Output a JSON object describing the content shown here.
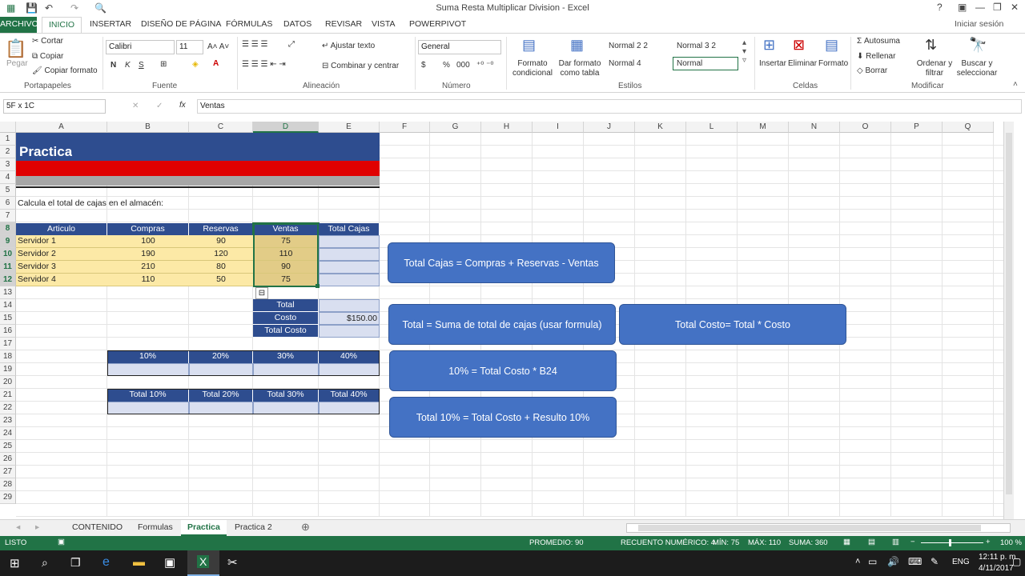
{
  "window": {
    "title": "Suma Resta Multiplicar Division - Excel",
    "help": "?",
    "user": "Iniciar sesión"
  },
  "tabs": [
    "ARCHIVO",
    "INICIO",
    "INSERTAR",
    "DISEÑO DE PÁGINA",
    "FÓRMULAS",
    "DATOS",
    "REVISAR",
    "VISTA",
    "POWERPIVOT"
  ],
  "ribbon": {
    "clipboard": {
      "paste": "Pegar",
      "cut": "Cortar",
      "copy": "Copiar",
      "format_painter": "Copiar formato",
      "group": "Portapapeles"
    },
    "font": {
      "name": "Calibri",
      "size": "11",
      "group": "Fuente",
      "bold": "N",
      "italic": "K",
      "underline": "S"
    },
    "alignment": {
      "wrap": "Ajustar texto",
      "merge": "Combinar y centrar",
      "group": "Alineación"
    },
    "number": {
      "format": "General",
      "group": "Número",
      "percent": "%",
      "thousands": "000"
    },
    "styles": {
      "cond": "Formato condicional",
      "table": "Dar formato como tabla",
      "s1": "Normal 2 2",
      "s2": "Normal 3 2",
      "s3": "Normal 4",
      "s4": "Normal",
      "group": "Estilos"
    },
    "cells": {
      "insert": "Insertar",
      "delete": "Eliminar",
      "format": "Formato",
      "group": "Celdas"
    },
    "editing": {
      "autosum": "Autosuma",
      "fill": "Rellenar",
      "clear": "Borrar",
      "sort": "Ordenar y filtrar",
      "find": "Buscar y seleccionar",
      "group": "Modificar"
    }
  },
  "formula_bar": {
    "namebox": "5F x 1C",
    "fx": "fx",
    "content": "Ventas"
  },
  "columns": [
    "A",
    "B",
    "C",
    "D",
    "E",
    "F",
    "G",
    "H",
    "I",
    "J",
    "K",
    "L",
    "M",
    "N",
    "O",
    "P",
    "Q"
  ],
  "rows": [
    "1",
    "2",
    "3",
    "4",
    "5",
    "6",
    "7",
    "8",
    "9",
    "10",
    "11",
    "12",
    "13",
    "14",
    "15",
    "16",
    "17",
    "18",
    "19",
    "20",
    "21",
    "22",
    "23",
    "24",
    "25",
    "26",
    "27",
    "28",
    "29"
  ],
  "sheet": {
    "banner_title": "Practica",
    "instruction": "Calcula el total de cajas en el almacén:",
    "table_headers": [
      "Articulo",
      "Compras",
      "Reservas",
      "Ventas",
      "Total Cajas"
    ],
    "table_rows": [
      [
        "Servidor 1",
        "100",
        "90",
        "75",
        ""
      ],
      [
        "Servidor 2",
        "190",
        "120",
        "110",
        ""
      ],
      [
        "Servidor 3",
        "210",
        "80",
        "90",
        ""
      ],
      [
        "Servidor 4",
        "110",
        "50",
        "75",
        ""
      ]
    ],
    "summary_labels": [
      "Total",
      "Costo",
      "Total Costo"
    ],
    "summary_values": [
      "",
      "$150.00",
      ""
    ],
    "pct_headers": [
      "10%",
      "20%",
      "30%",
      "40%"
    ],
    "total_headers": [
      "Total 10%",
      "Total 20%",
      "Total 30%",
      "Total 40%"
    ]
  },
  "callouts": {
    "c1": "Total Cajas = Compras + Reservas - Ventas",
    "c2": "Total = Suma de total de cajas (usar formula)",
    "c3": "Total Costo= Total * Costo",
    "c4": "10% = Total Costo * B24",
    "c5": "Total 10% = Total Costo + Resulto 10%"
  },
  "sheet_tabs": [
    "CONTENIDO",
    "Formulas",
    "Practica",
    "Practica 2"
  ],
  "status": {
    "ready": "LISTO",
    "avg": "PROMEDIO: 90",
    "count": "RECUENTO NUMÉRICO: 4",
    "min": "MÍN: 75",
    "max": "MÁX: 110",
    "sum": "SUMA: 360",
    "zoom": "100 %"
  },
  "taskbar": {
    "lang": "ENG",
    "time": "12:11 p. m.",
    "date": "4/11/2017"
  },
  "colors": {
    "excel_green": "#217346",
    "header_blue": "#2e4d8f",
    "banner_red": "#e00000",
    "callout_blue": "#4472c4",
    "yellow": "#fce9a6"
  }
}
